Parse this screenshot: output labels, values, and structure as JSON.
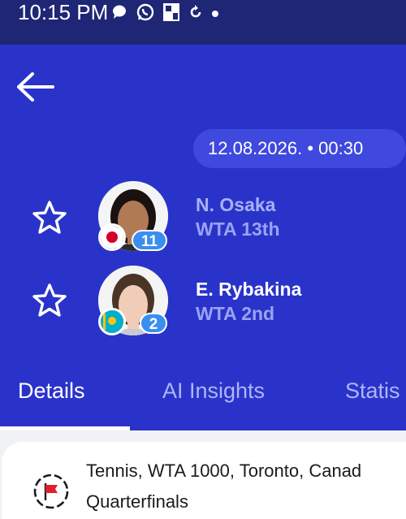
{
  "status_bar": {
    "time": "10:15 PM",
    "icons": [
      "chat-bubble-icon",
      "whatsapp-icon",
      "id-card-icon",
      "sync-icon",
      "dot-icon"
    ]
  },
  "match": {
    "date_time": "12.08.2026. • 00:30",
    "players": [
      {
        "name": "N. Osaka",
        "rank": "WTA 13th",
        "seed": "11",
        "flag": "japan-flag",
        "name_color": "#a7b0f8"
      },
      {
        "name": "E. Rybakina",
        "rank": "WTA 2nd",
        "seed": "2",
        "flag": "kazakhstan-flag",
        "name_color": "#ffffff"
      }
    ]
  },
  "tabs": [
    {
      "label": "Details",
      "active": true
    },
    {
      "label": "AI Insights",
      "active": false
    },
    {
      "label": "Statis",
      "active": false
    }
  ],
  "tournament": {
    "line1": "Tennis, WTA 1000, Toronto, Canad",
    "line2": "Quarterfinals"
  },
  "colors": {
    "header_bg": "#2a33c9",
    "status_bg": "#1f2675",
    "seed_badge": "#3a8ef0"
  }
}
